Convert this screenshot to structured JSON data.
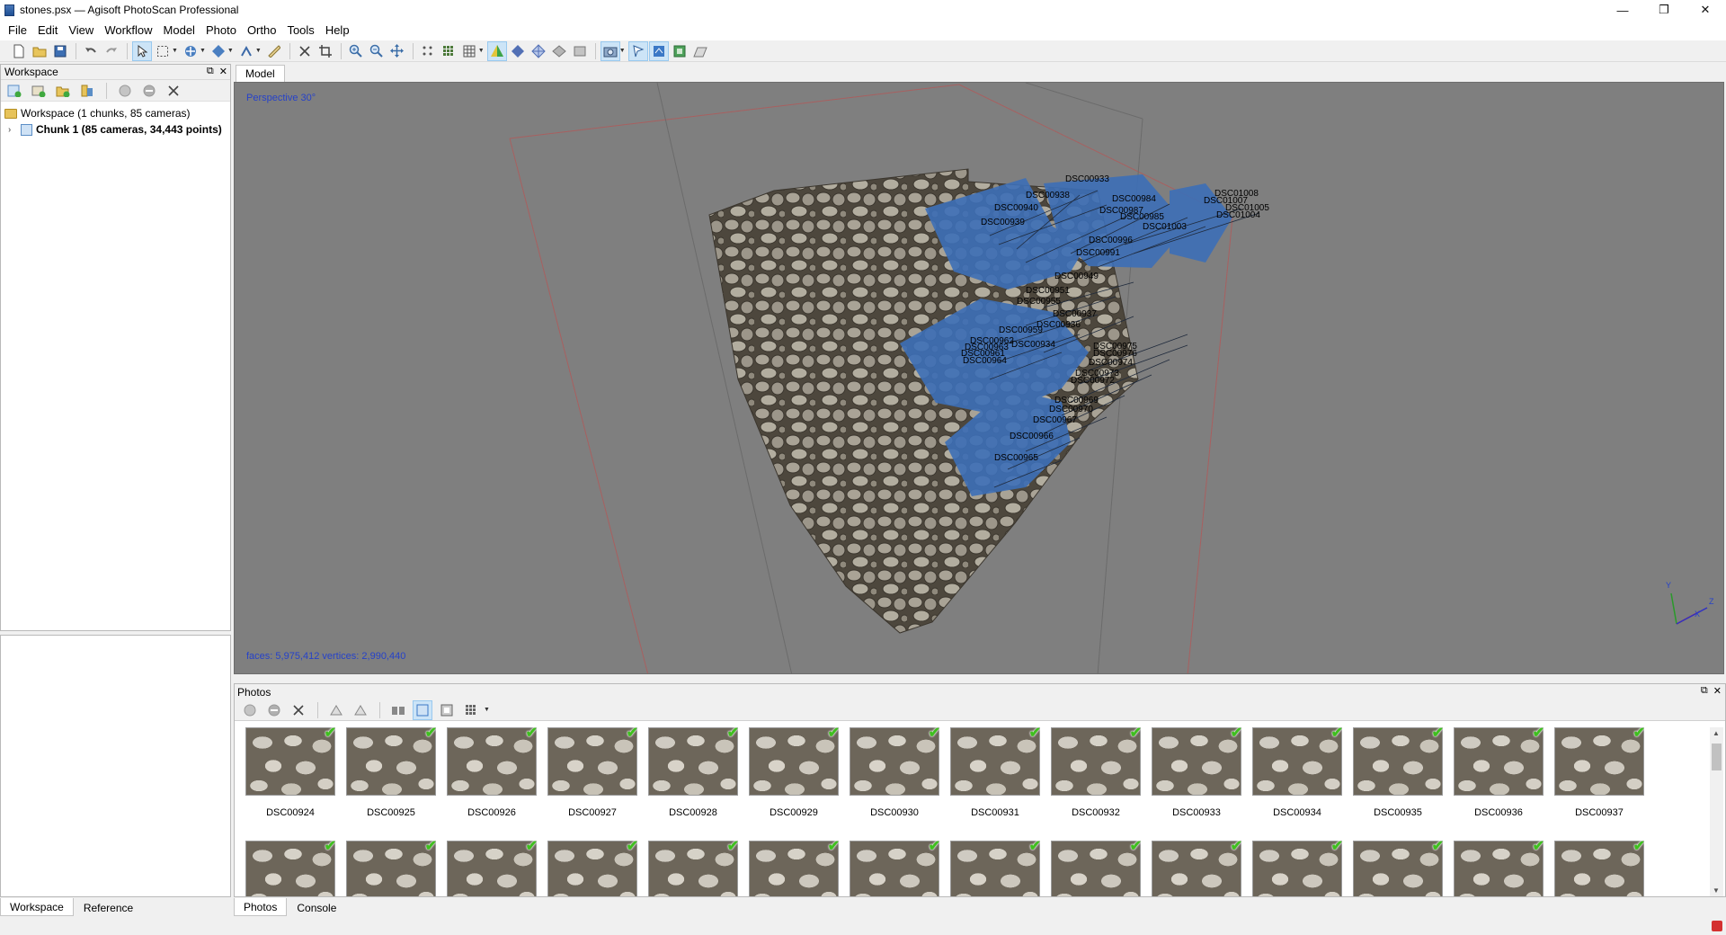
{
  "window": {
    "title": "stones.psx — Agisoft PhotoScan Professional",
    "minimize": "—",
    "restore": "❐",
    "close": "✕"
  },
  "menu": [
    "File",
    "Edit",
    "View",
    "Workflow",
    "Model",
    "Photo",
    "Ortho",
    "Tools",
    "Help"
  ],
  "workspace": {
    "title": "Workspace",
    "root": "Workspace (1 chunks, 85 cameras)",
    "chunk": "Chunk 1 (85 cameras, 34,443 points)"
  },
  "left_tabs": [
    "Workspace",
    "Reference"
  ],
  "model": {
    "tab": "Model",
    "projection": "Perspective 30°",
    "stats": "faces: 5,975,412 vertices: 2,990,440",
    "axis_x": "X",
    "axis_y": "Y",
    "axis_z": "Z",
    "camera_labels": [
      "DSC00933",
      "DSC00938",
      "DSC00940",
      "DSC00939",
      "DSC00984",
      "DSC00987",
      "DSC00985",
      "DSC01003",
      "DSC00996",
      "DSC00991",
      "DSC01008",
      "DSC01007",
      "DSC01005",
      "DSC01004",
      "DSC00949",
      "DSC00951",
      "DSC00955",
      "DSC00937",
      "DSC00936",
      "DSC00959",
      "DSC00962",
      "DSC00961",
      "DSC00934",
      "DSC00963",
      "DSC00964",
      "DSC00975",
      "DSC00976",
      "DSC00974",
      "DSC00973",
      "DSC00972",
      "DSC00969",
      "DSC00970",
      "DSC00967",
      "DSC00966",
      "DSC00965"
    ]
  },
  "photos": {
    "title": "Photos",
    "row1": [
      "DSC00924",
      "DSC00925",
      "DSC00926",
      "DSC00927",
      "DSC00928",
      "DSC00929",
      "DSC00930",
      "DSC00931",
      "DSC00932",
      "DSC00933",
      "DSC00934",
      "DSC00935",
      "DSC00936",
      "DSC00937"
    ]
  },
  "right_tabs": [
    "Photos",
    "Console"
  ]
}
